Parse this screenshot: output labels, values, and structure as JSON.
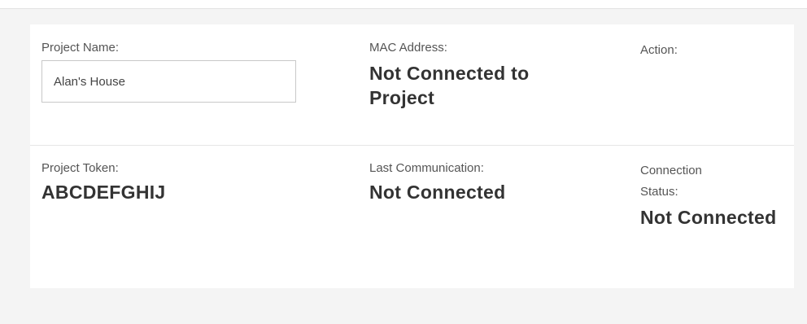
{
  "project": {
    "name_label": "Project Name:",
    "name_value": "Alan's House",
    "mac_label": "MAC Address:",
    "mac_value": "Not Connected to Project",
    "action_label": "Action:",
    "token_label": "Project Token:",
    "token_value": "ABCDEFGHIJ",
    "last_comm_label": "Last Communication:",
    "last_comm_value": "Not Connected",
    "status_label": "Connection Status:",
    "status_value": "Not Connected"
  }
}
